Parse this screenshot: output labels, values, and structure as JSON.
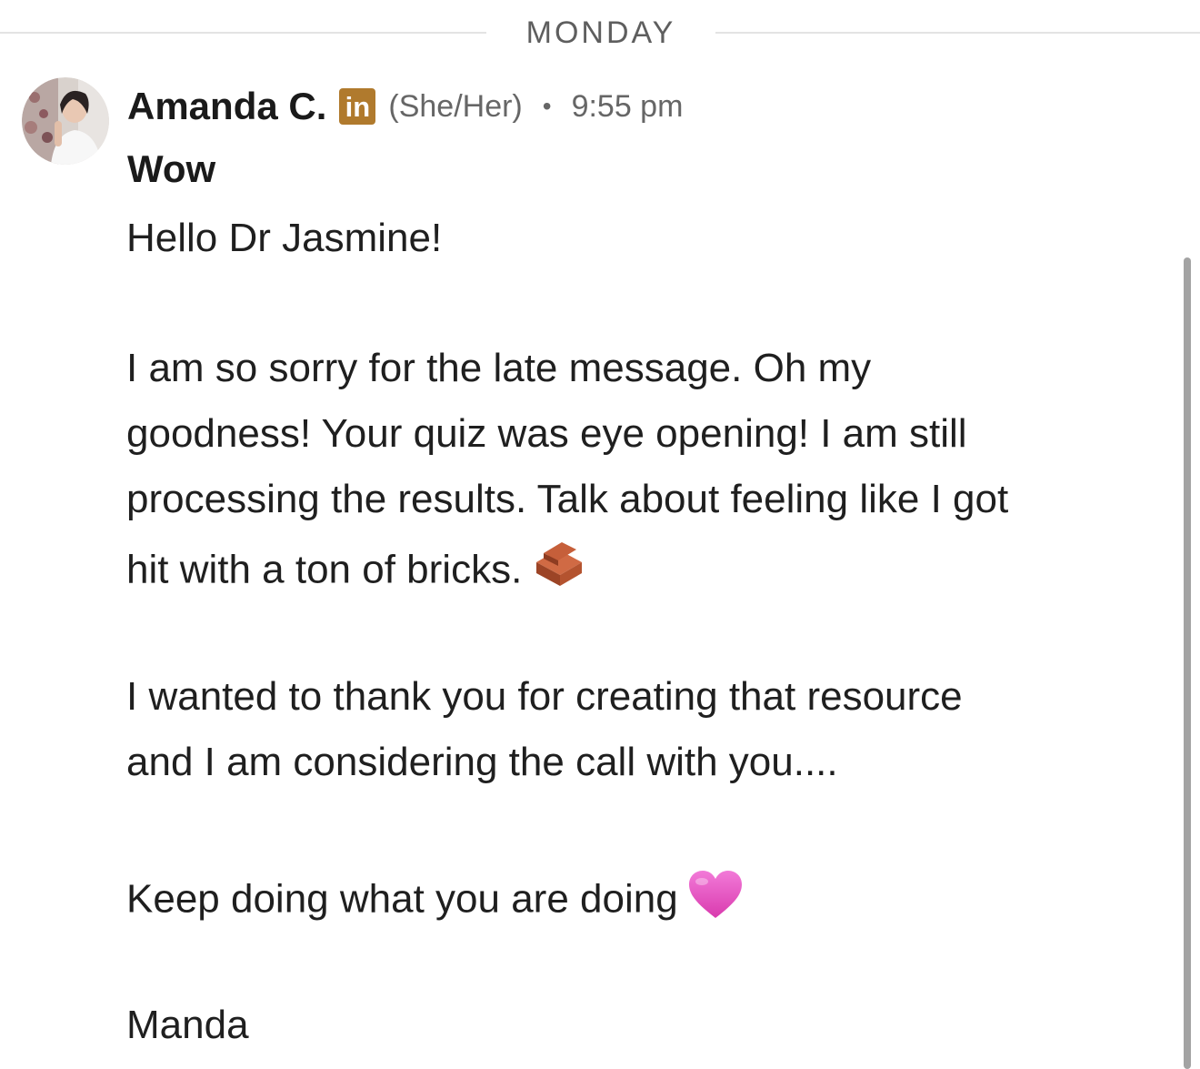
{
  "divider": {
    "label": "MONDAY"
  },
  "message": {
    "sender_name": "Amanda C.",
    "linkedin_badge": "in",
    "pronouns": "(She/Her)",
    "separator": "•",
    "timestamp": "9:55 pm",
    "subject": "Wow",
    "lines": [
      "Hello Dr Jasmine!",
      "I am so sorry for the late message. Oh my",
      "goodness! Your quiz was eye opening! I am still",
      "processing the results. Talk about feeling like I got",
      "hit with a ton of bricks.",
      "I wanted to thank you for creating that resource",
      "and I am considering the call with you....",
      "Keep doing what you are doing",
      "Manda"
    ],
    "emojis": {
      "bricks": "brick-icon",
      "heart": "pink-heart-icon"
    }
  },
  "colors": {
    "linkedin_badge": "#b07a2d",
    "muted_text": "#666666",
    "divider_line": "#e3e3e3",
    "heart": "#e34bbd",
    "brick": "#b4532f"
  }
}
